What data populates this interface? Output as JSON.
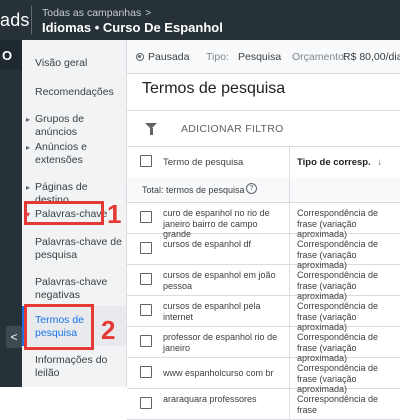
{
  "header": {
    "brand": "ads",
    "breadcrumb_parent": "Todas as campanhas",
    "breadcrumb_chevron": ">",
    "title": "Idiomas • Curso De Espanhol"
  },
  "rail": {
    "letter": "O",
    "collapse_glyph": "<"
  },
  "sidebar": {
    "items": [
      {
        "label": "Visão geral"
      },
      {
        "label": "Recomendações"
      },
      {
        "label": "Grupos de anúncios",
        "arrow": "▸"
      },
      {
        "label": "Anúncios e extensões",
        "arrow": "▸"
      },
      {
        "label": "Páginas de destino",
        "arrow": "▸"
      },
      {
        "label": "Palavras-chave",
        "arrow": "▾"
      },
      {
        "label": "Palavras-chave de pesquisa"
      },
      {
        "label": "Palavras-chave negativas"
      },
      {
        "label": "Termos de pesquisa",
        "active": true
      },
      {
        "label": "Informações do leilão"
      }
    ]
  },
  "annotations": {
    "badge1": "1",
    "badge2": "2",
    "color": "#e53935"
  },
  "status": {
    "state": "Pausada",
    "tipo_label": "Tipo:",
    "tipo_value": "Pesquisa",
    "orcamento_label": "Orçamento:",
    "orcamento_value": "R$ 80,00/dia"
  },
  "page": {
    "title": "Termos de pesquisa",
    "add_filter": "ADICIONAR FILTRO"
  },
  "table": {
    "col_term": "Termo de pesquisa",
    "col_match": "Tipo de corresp.",
    "sort_glyph": "↓",
    "total_label": "Total: termos de pesquisa",
    "help_glyph": "?",
    "rows": [
      {
        "term": "curo de espanhol no rio de janeiro bairro de campo grande",
        "match": "Correspondência de frase (variação aproximada)"
      },
      {
        "term": "cursos de espanhol df",
        "match": "Correspondência de frase (variação aproximada)"
      },
      {
        "term": "cursos de espanhol em joão pessoa",
        "match": "Correspondência de frase (variação aproximada)"
      },
      {
        "term": "cursos de espanhol pela internet",
        "match": "Correspondência de frase (variação aproximada)"
      },
      {
        "term": "professor de espanhol rio de janeiro",
        "match": "Correspondência de frase (variação aproximada)"
      },
      {
        "term": "www espanholcurso com br",
        "match": "Correspondência de frase (variação aproximada)"
      },
      {
        "term": "araraquara professores",
        "match": "Correspondência de frase"
      }
    ]
  },
  "colors": {
    "topbar": "#263238",
    "accent": "#1a73e8",
    "annotation": "#e53935"
  }
}
